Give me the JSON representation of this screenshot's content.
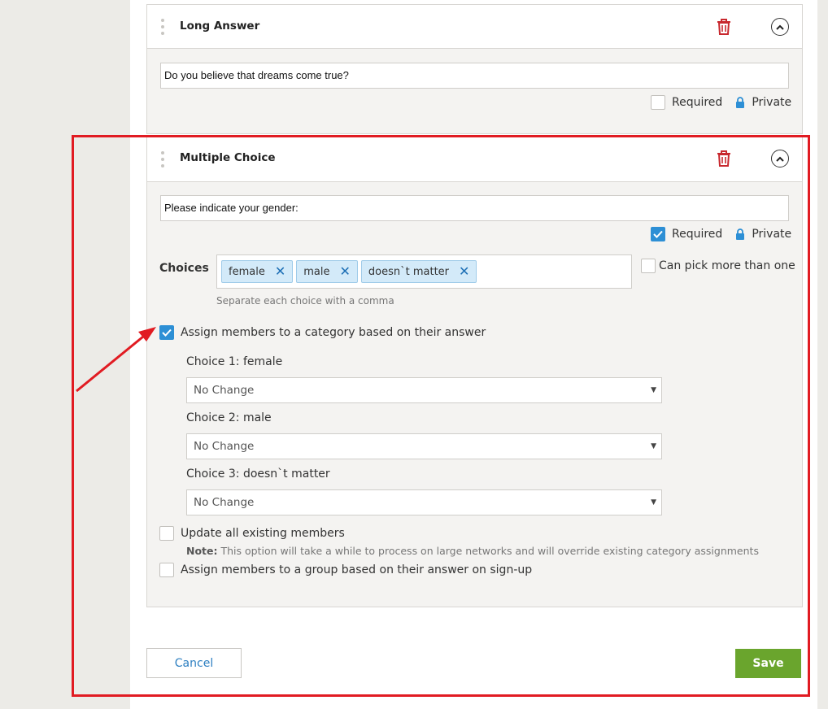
{
  "long_answer": {
    "title": "Long Answer",
    "question": "Do you believe that dreams come true?",
    "required_label": "Required",
    "required_checked": false,
    "private_label": "Private"
  },
  "multiple_choice": {
    "title": "Multiple Choice",
    "question": "Please indicate your gender:",
    "required_label": "Required",
    "required_checked": true,
    "private_label": "Private",
    "choices_label": "Choices",
    "choices": [
      "female",
      "male",
      "doesn`t matter"
    ],
    "choices_hint": "Separate each choice with a comma",
    "can_pick_more_label": "Can pick more than one",
    "assign_category_label": "Assign members to a category based on their answer",
    "assign_category_checked": true,
    "choice_mappings": [
      {
        "label": "Choice 1: female",
        "selected": "No Change"
      },
      {
        "label": "Choice 2: male",
        "selected": "No Change"
      },
      {
        "label": "Choice 3: doesn`t matter",
        "selected": "No Change"
      }
    ],
    "update_existing_label": "Update all existing members",
    "note_prefix": "Note:",
    "note_text": " This option will take a while to process on large networks and will override existing category assignments",
    "assign_group_label": "Assign members to a group based on their answer on sign-up"
  },
  "actions": {
    "cancel_label": "Cancel",
    "save_label": "Save"
  },
  "colors": {
    "accent_blue": "#2d8fd5",
    "save_green": "#6aa52d",
    "delete_red": "#c8282e",
    "annotation_red": "#e11b22"
  }
}
